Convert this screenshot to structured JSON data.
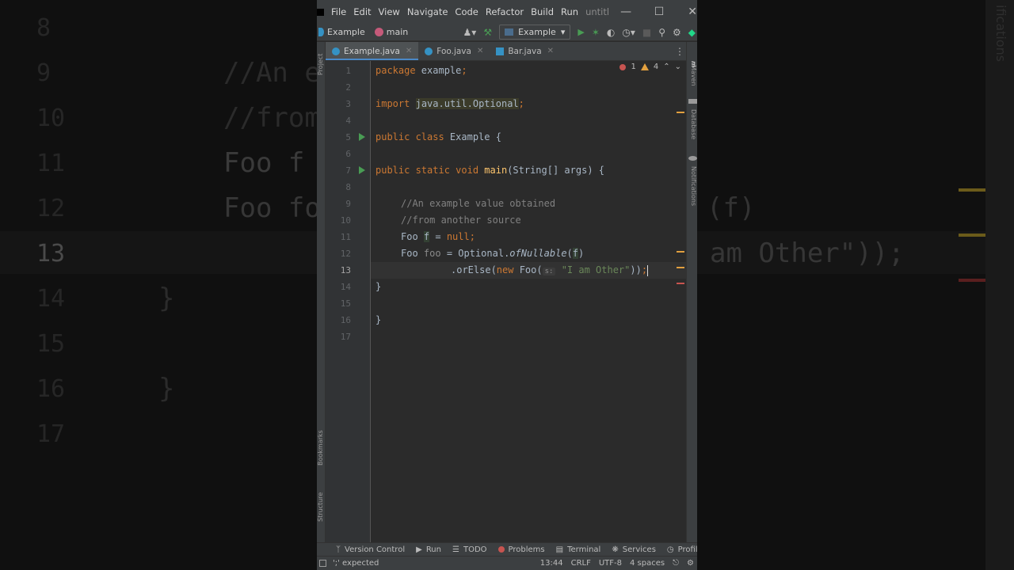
{
  "menu": {
    "items": [
      "File",
      "Edit",
      "View",
      "Navigate",
      "Code",
      "Refactor",
      "Build",
      "Run"
    ],
    "overflow_title": "untitl"
  },
  "nav": {
    "project": "Example",
    "branch": "main",
    "run_config": "Example"
  },
  "tabs": [
    {
      "label": "Example.java",
      "active": true
    },
    {
      "label": "Foo.java",
      "active": false
    },
    {
      "label": "Bar.java",
      "active": false
    }
  ],
  "inspections": {
    "errors": "1",
    "warnings": "4"
  },
  "code": {
    "line_numbers": [
      "1",
      "2",
      "3",
      "4",
      "5",
      "6",
      "7",
      "8",
      "9",
      "10",
      "11",
      "12",
      "13",
      "14",
      "15",
      "16",
      "17"
    ],
    "current_line": "13",
    "l1_kw": "package",
    "l1_rest": " example",
    "l1_semi": ";",
    "l3_kw": "import",
    "l3_pkg": "java.util.Optional",
    "l3_semi": ";",
    "l5_kw": "public class",
    "l5_name": " Example {",
    "l7_kw": "public static void",
    "l7_fn": "main",
    "l7_rest": "(String[] args) {",
    "l9_comment": "//An example value obtained",
    "l10_comment": "//from another source",
    "l11_type": "Foo ",
    "l11_var": "f",
    "l11_eq": " = ",
    "l11_null": "null",
    "l11_semi": ";",
    "l12_type": "Foo ",
    "l12_var": "foo",
    "l12_eq": " = Optional.",
    "l12_fn": "ofNullable",
    "l12_open": "(",
    "l12_arg": "f",
    "l12_close": ")",
    "l13_dot": ".orElse(",
    "l13_new": "new",
    "l13_foo": " Foo(",
    "l13_hint": "s:",
    "l13_str": "\"I am Other\"",
    "l13_end": "))",
    "l13_semi": ";",
    "l14": "}",
    "l16": "}"
  },
  "left_tools": [
    "Project",
    "Bookmarks",
    "Structure"
  ],
  "right_tools": [
    "Maven",
    "Database",
    "Notifications"
  ],
  "toolwindows": [
    "Version Control",
    "Run",
    "TODO",
    "Problems",
    "Terminal",
    "Services",
    "Profiler"
  ],
  "status": {
    "message": "';' expected",
    "position": "13:44",
    "line_sep": "CRLF",
    "encoding": "UTF-8",
    "indent": "4 spaces"
  },
  "background": {
    "lines": [
      "//An e",
      "//from",
      "Foo f",
      "Foo fo",
      "(f)",
      "am Other\"));",
      "}",
      "}"
    ],
    "numbers": [
      "8",
      "9",
      "10",
      "11",
      "12",
      "13",
      "14",
      "15",
      "16",
      "17"
    ],
    "right_label": "ifications"
  },
  "colors": {
    "keyword": "#cc7832",
    "function": "#ffc66d",
    "string": "#6a8759",
    "comment": "#808080",
    "error": "#c75450",
    "warning": "#e2a03f",
    "run": "#499c54",
    "accent": "#4a88c7"
  }
}
